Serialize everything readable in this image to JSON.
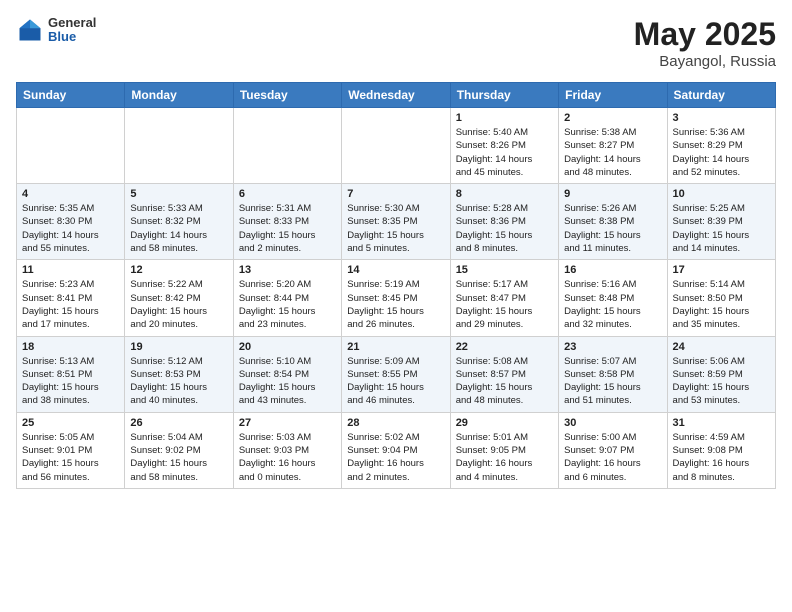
{
  "header": {
    "logo_general": "General",
    "logo_blue": "Blue",
    "title": "May 2025",
    "location": "Bayangol, Russia"
  },
  "weekdays": [
    "Sunday",
    "Monday",
    "Tuesday",
    "Wednesday",
    "Thursday",
    "Friday",
    "Saturday"
  ],
  "weeks": [
    [
      {
        "day": "",
        "detail": ""
      },
      {
        "day": "",
        "detail": ""
      },
      {
        "day": "",
        "detail": ""
      },
      {
        "day": "",
        "detail": ""
      },
      {
        "day": "1",
        "detail": "Sunrise: 5:40 AM\nSunset: 8:26 PM\nDaylight: 14 hours\nand 45 minutes."
      },
      {
        "day": "2",
        "detail": "Sunrise: 5:38 AM\nSunset: 8:27 PM\nDaylight: 14 hours\nand 48 minutes."
      },
      {
        "day": "3",
        "detail": "Sunrise: 5:36 AM\nSunset: 8:29 PM\nDaylight: 14 hours\nand 52 minutes."
      }
    ],
    [
      {
        "day": "4",
        "detail": "Sunrise: 5:35 AM\nSunset: 8:30 PM\nDaylight: 14 hours\nand 55 minutes."
      },
      {
        "day": "5",
        "detail": "Sunrise: 5:33 AM\nSunset: 8:32 PM\nDaylight: 14 hours\nand 58 minutes."
      },
      {
        "day": "6",
        "detail": "Sunrise: 5:31 AM\nSunset: 8:33 PM\nDaylight: 15 hours\nand 2 minutes."
      },
      {
        "day": "7",
        "detail": "Sunrise: 5:30 AM\nSunset: 8:35 PM\nDaylight: 15 hours\nand 5 minutes."
      },
      {
        "day": "8",
        "detail": "Sunrise: 5:28 AM\nSunset: 8:36 PM\nDaylight: 15 hours\nand 8 minutes."
      },
      {
        "day": "9",
        "detail": "Sunrise: 5:26 AM\nSunset: 8:38 PM\nDaylight: 15 hours\nand 11 minutes."
      },
      {
        "day": "10",
        "detail": "Sunrise: 5:25 AM\nSunset: 8:39 PM\nDaylight: 15 hours\nand 14 minutes."
      }
    ],
    [
      {
        "day": "11",
        "detail": "Sunrise: 5:23 AM\nSunset: 8:41 PM\nDaylight: 15 hours\nand 17 minutes."
      },
      {
        "day": "12",
        "detail": "Sunrise: 5:22 AM\nSunset: 8:42 PM\nDaylight: 15 hours\nand 20 minutes."
      },
      {
        "day": "13",
        "detail": "Sunrise: 5:20 AM\nSunset: 8:44 PM\nDaylight: 15 hours\nand 23 minutes."
      },
      {
        "day": "14",
        "detail": "Sunrise: 5:19 AM\nSunset: 8:45 PM\nDaylight: 15 hours\nand 26 minutes."
      },
      {
        "day": "15",
        "detail": "Sunrise: 5:17 AM\nSunset: 8:47 PM\nDaylight: 15 hours\nand 29 minutes."
      },
      {
        "day": "16",
        "detail": "Sunrise: 5:16 AM\nSunset: 8:48 PM\nDaylight: 15 hours\nand 32 minutes."
      },
      {
        "day": "17",
        "detail": "Sunrise: 5:14 AM\nSunset: 8:50 PM\nDaylight: 15 hours\nand 35 minutes."
      }
    ],
    [
      {
        "day": "18",
        "detail": "Sunrise: 5:13 AM\nSunset: 8:51 PM\nDaylight: 15 hours\nand 38 minutes."
      },
      {
        "day": "19",
        "detail": "Sunrise: 5:12 AM\nSunset: 8:53 PM\nDaylight: 15 hours\nand 40 minutes."
      },
      {
        "day": "20",
        "detail": "Sunrise: 5:10 AM\nSunset: 8:54 PM\nDaylight: 15 hours\nand 43 minutes."
      },
      {
        "day": "21",
        "detail": "Sunrise: 5:09 AM\nSunset: 8:55 PM\nDaylight: 15 hours\nand 46 minutes."
      },
      {
        "day": "22",
        "detail": "Sunrise: 5:08 AM\nSunset: 8:57 PM\nDaylight: 15 hours\nand 48 minutes."
      },
      {
        "day": "23",
        "detail": "Sunrise: 5:07 AM\nSunset: 8:58 PM\nDaylight: 15 hours\nand 51 minutes."
      },
      {
        "day": "24",
        "detail": "Sunrise: 5:06 AM\nSunset: 8:59 PM\nDaylight: 15 hours\nand 53 minutes."
      }
    ],
    [
      {
        "day": "25",
        "detail": "Sunrise: 5:05 AM\nSunset: 9:01 PM\nDaylight: 15 hours\nand 56 minutes."
      },
      {
        "day": "26",
        "detail": "Sunrise: 5:04 AM\nSunset: 9:02 PM\nDaylight: 15 hours\nand 58 minutes."
      },
      {
        "day": "27",
        "detail": "Sunrise: 5:03 AM\nSunset: 9:03 PM\nDaylight: 16 hours\nand 0 minutes."
      },
      {
        "day": "28",
        "detail": "Sunrise: 5:02 AM\nSunset: 9:04 PM\nDaylight: 16 hours\nand 2 minutes."
      },
      {
        "day": "29",
        "detail": "Sunrise: 5:01 AM\nSunset: 9:05 PM\nDaylight: 16 hours\nand 4 minutes."
      },
      {
        "day": "30",
        "detail": "Sunrise: 5:00 AM\nSunset: 9:07 PM\nDaylight: 16 hours\nand 6 minutes."
      },
      {
        "day": "31",
        "detail": "Sunrise: 4:59 AM\nSunset: 9:08 PM\nDaylight: 16 hours\nand 8 minutes."
      }
    ]
  ]
}
